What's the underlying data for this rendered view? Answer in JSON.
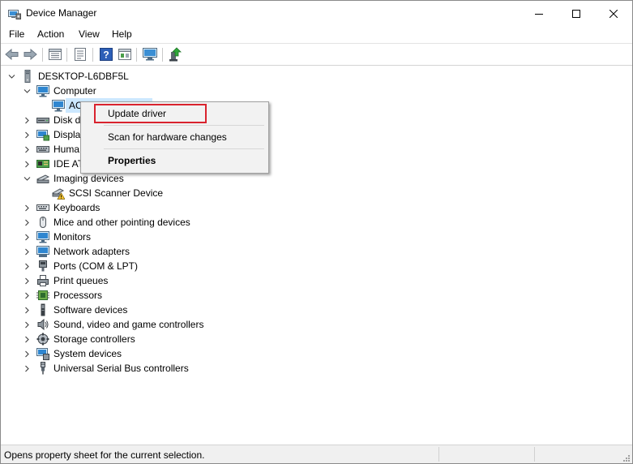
{
  "window": {
    "title": "Device Manager",
    "controls": {
      "minimize": "minimize",
      "maximize": "maximize",
      "close": "close"
    }
  },
  "menu": [
    "File",
    "Action",
    "View",
    "Help"
  ],
  "toolbar": {
    "buttons": [
      "back-icon",
      "forward-icon",
      "device-view-icon",
      "properties-icon",
      "help-icon",
      "show-hidden-icon",
      "scan-hardware-icon",
      "update-driver-icon"
    ]
  },
  "tree": {
    "root": "DESKTOP-L6DBF5L",
    "nodes": [
      {
        "label": "Computer",
        "expanded": true,
        "icon": "computer-icon"
      },
      {
        "label": "AC",
        "icon": "monitor-icon",
        "child": true,
        "selected": true
      },
      {
        "label": "Disk d",
        "icon": "disk-drive-icon"
      },
      {
        "label": "Displa",
        "icon": "display-adapter-icon"
      },
      {
        "label": "Huma",
        "icon": "human-interface-icon"
      },
      {
        "label": "IDE AT",
        "icon": "ide-controller-icon"
      },
      {
        "label": "Imaging devices",
        "expanded": true,
        "icon": "imaging-icon"
      },
      {
        "label": "SCSI Scanner Device",
        "icon": "scanner-warning-icon",
        "child": true
      },
      {
        "label": "Keyboards",
        "icon": "keyboard-icon"
      },
      {
        "label": "Mice and other pointing devices",
        "icon": "mouse-icon"
      },
      {
        "label": "Monitors",
        "icon": "monitor-icon"
      },
      {
        "label": "Network adapters",
        "icon": "network-adapter-icon"
      },
      {
        "label": "Ports (COM & LPT)",
        "icon": "port-icon"
      },
      {
        "label": "Print queues",
        "icon": "printer-icon"
      },
      {
        "label": "Processors",
        "icon": "processor-icon"
      },
      {
        "label": "Software devices",
        "icon": "software-device-icon"
      },
      {
        "label": "Sound, video and game controllers",
        "icon": "sound-icon"
      },
      {
        "label": "Storage controllers",
        "icon": "storage-controller-icon"
      },
      {
        "label": "System devices",
        "icon": "system-device-icon"
      },
      {
        "label": "Universal Serial Bus controllers",
        "icon": "usb-icon"
      }
    ]
  },
  "context_menu": {
    "items": [
      "Update driver",
      "Scan for hardware changes",
      "Properties"
    ],
    "highlight_color": "#d9232e"
  },
  "status": {
    "text": "Opens property sheet for the current selection."
  },
  "colors": {
    "selection": "#cce8ff",
    "accent": "#0078d7"
  }
}
